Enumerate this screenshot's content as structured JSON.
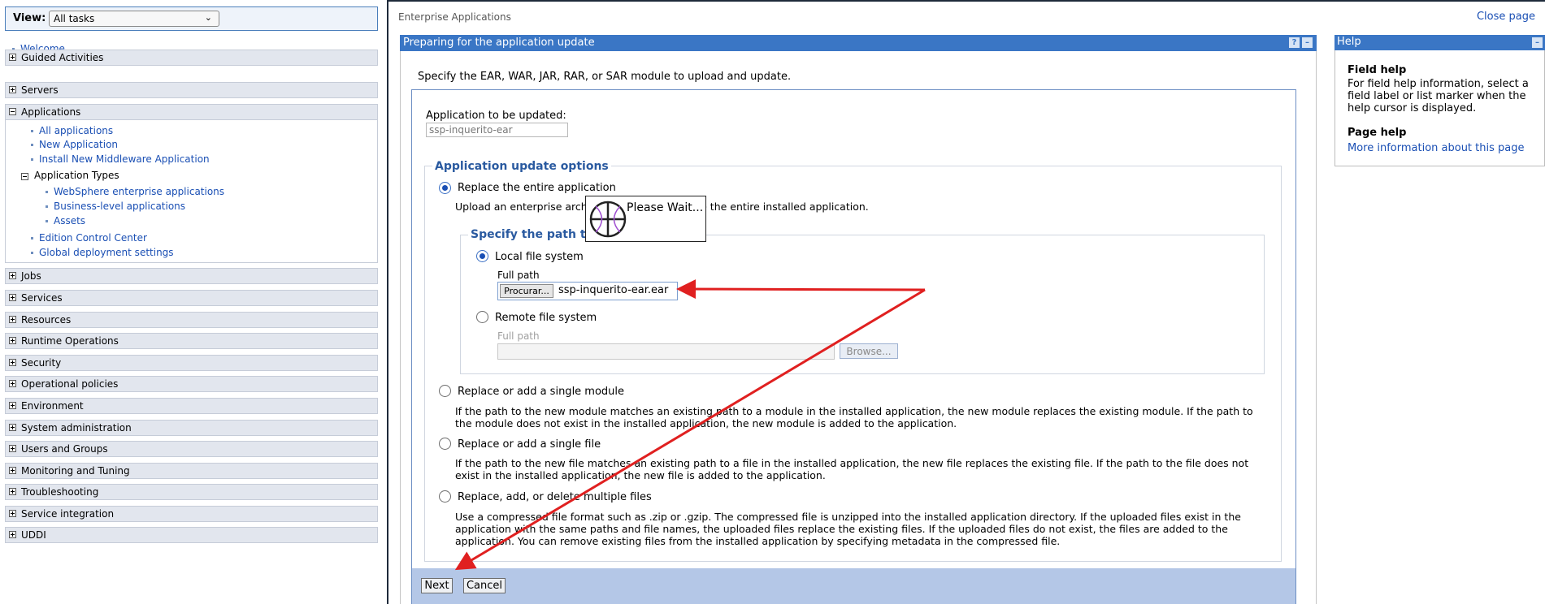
{
  "nav": {
    "view_label": "View:",
    "view_value": "All tasks",
    "welcome": "Welcome",
    "categories": [
      "Guided Activities",
      "Servers",
      "Applications",
      "Jobs",
      "Services",
      "Resources",
      "Runtime Operations",
      "Security",
      "Operational policies",
      "Environment",
      "System administration",
      "Users and Groups",
      "Monitoring and Tuning",
      "Troubleshooting",
      "Service integration",
      "UDDI"
    ],
    "applications_items": [
      "All applications",
      "New Application",
      "Install New Middleware Application"
    ],
    "application_types_label": "Application Types",
    "application_types_items": [
      "WebSphere enterprise applications",
      "Business-level applications",
      "Assets"
    ],
    "applications_items_after": [
      "Edition Control Center",
      "Global deployment settings"
    ]
  },
  "header": {
    "breadcrumb": "Enterprise Applications",
    "close_page": "Close page"
  },
  "main": {
    "title": "Preparing for the application update",
    "help_icon": "?",
    "minimize_icon": "–",
    "intro": "Specify the EAR, WAR, JAR, RAR, or SAR module to upload and update.",
    "app_label": "Application to be updated:",
    "app_value": "ssp-inquerito-ear",
    "options_legend": "Application update options",
    "opt_replace_entire": "Replace the entire application",
    "opt_replace_entire_desc": "Upload an enterprise archive file (EAR) to replace the entire installed application.",
    "path_legend": "Specify the path to the new file.",
    "local_label": "Local file system",
    "full_path_label": "Full path",
    "browse_native_label": "Procurar...",
    "local_value": "ssp-inquerito-ear.ear",
    "remote_label": "Remote file system",
    "remote_full_path_label": "Full path",
    "browse_label": "Browse...",
    "opt_single_module": "Replace or add a single module",
    "opt_single_module_desc": "If the path to the new module matches an existing path to a module in the installed application, the new module replaces the existing module. If the path to the module does not exist in the installed application, the new module is added to the application.",
    "opt_single_file": "Replace or add a single file",
    "opt_single_file_desc": "If the path to the new file matches an existing path to a file in the installed application, the new file replaces the existing file. If the path to the file does not exist in the installed application, the new file is added to the application.",
    "opt_multiple": "Replace, add, or delete multiple files",
    "opt_multiple_desc": "Use a compressed file format such as .zip or .gzip. The compressed file is unzipped into the installed application directory. If the uploaded files exist in the application with the same paths and file names, the uploaded files replace the existing files. If the uploaded files do not exist, the files are added to the application. You can remove existing files from the installed application by specifying metadata in the compressed file.",
    "next": "Next",
    "cancel": "Cancel"
  },
  "help": {
    "title": "Help",
    "minimize_icon": "–",
    "field_help_title": "Field help",
    "field_help_text": "For field help information, select a field label or list marker when the help cursor is displayed.",
    "page_help_title": "Page help",
    "page_help_link": "More information about this page"
  },
  "overlay": {
    "text": "Please Wait..."
  },
  "colors": {
    "header_blue": "#3a76c5",
    "button_bar": "#b4c7e7",
    "link": "#1a4fb4",
    "annotation_arrow": "#e02020"
  }
}
